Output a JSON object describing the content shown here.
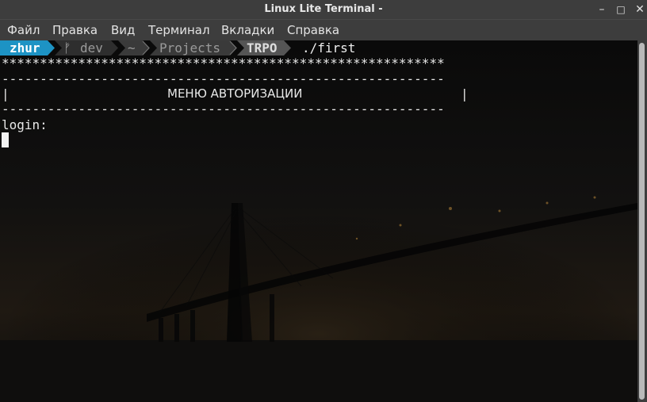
{
  "window": {
    "title": "Linux Lite Terminal -",
    "controls": {
      "minimize": "–",
      "maximize": "□",
      "close": "✕"
    }
  },
  "menu": [
    "Файл",
    "Правка",
    "Вид",
    "Терминал",
    "Вкладки",
    "Справка"
  ],
  "prompt": {
    "user": "zhur",
    "branch_icon": "git-branch-icon",
    "branch": "dev",
    "path": [
      "~",
      "Projects",
      "TRPO"
    ],
    "command": "./first"
  },
  "output": {
    "stars": "**********************************************************",
    "dashes": "----------------------------------------------------------",
    "bar_left": "|",
    "heading": "МЕНЮ АВТОРИЗАЦИИ",
    "bar_right": "|",
    "login_prompt": "login:"
  },
  "colors": {
    "user_segment_bg": "#1d93c4",
    "path_segment_bg": "#3a3a3a",
    "current_dir_bg": "#555555",
    "terminal_bg": "#0b0b0b",
    "chrome_bg": "#3d3d3d"
  }
}
